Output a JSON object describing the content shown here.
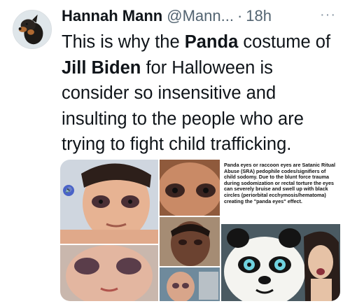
{
  "tweet": {
    "author_name": "Hannah Mann",
    "handle": "@Mann...",
    "separator": "·",
    "time": "18h",
    "more": "···",
    "text_parts": [
      "This is why the ",
      "Panda",
      " costume of ",
      "Jill Biden",
      " for Halloween is consider so insensitive and insulting to the people who are trying to fight child trafficking."
    ]
  },
  "media": {
    "caption": "Panda eyes or raccoon eyes are Satanic Ritual Abuse (SRA) pedophile codes/signifiers of child sodomy. Due to the blunt force trauma during sodomization or rectal torture the eyes can severely bruise and swell up with black circles (periorbital ecchymosis/hematoma) creating the \"panda eyes\" effect.",
    "icons": [
      "avatar-dog",
      "volume-icon"
    ]
  }
}
